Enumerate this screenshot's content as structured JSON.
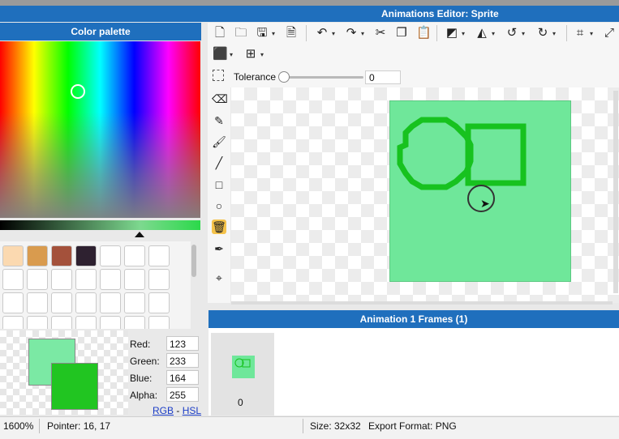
{
  "window": {
    "title": "Animations Editor: Sprite"
  },
  "palette": {
    "title": "Color palette",
    "swatch_colors": [
      "#fbd9b0",
      "#d99b4e",
      "#a4513b",
      "#2e2130"
    ],
    "rgb": {
      "red_label": "Red:",
      "red": "123",
      "green_label": "Green:",
      "green": "233",
      "blue_label": "Blue:",
      "blue": "164",
      "alpha_label": "Alpha:",
      "alpha": "255"
    },
    "mode_rgb": "RGB",
    "mode_sep": "-",
    "mode_hsl": "HSL",
    "primary_color": "#7be9a4",
    "secondary_color": "#21c521"
  },
  "toolbar": {
    "icons": [
      "new-file-icon",
      "open-folder-icon",
      "save-icon",
      "export-icon",
      "undo-icon",
      "redo-icon",
      "cut-icon",
      "copy-icon",
      "paste-icon",
      "flip-horizontal-icon",
      "flip-vertical-icon",
      "rotate-left-icon",
      "rotate-right-icon",
      "crop-icon",
      "resize-icon",
      "layers-icon",
      "grid-icon"
    ],
    "tolerance_label": "Tolerance",
    "tolerance_value": "0",
    "tolerance_level": 0
  },
  "tools": [
    "select-icon",
    "eraser-icon",
    "pencil-icon",
    "brush-icon",
    "line-icon",
    "rectangle-icon",
    "ellipse-icon",
    "fill-bucket-icon",
    "eyedropper-icon",
    "crosshair-icon"
  ],
  "active_tool": "fill-bucket-icon",
  "canvas": {
    "sprite_color": "#6fe79a",
    "stroke_color": "#17c21f"
  },
  "frames": {
    "title": "Animation 1 Frames (1)",
    "items": [
      {
        "number": "0"
      }
    ]
  },
  "status": {
    "zoom": "1600%",
    "pointer": "Pointer: 16, 17",
    "size": "Size: 32x32",
    "format": "Export Format: PNG"
  }
}
